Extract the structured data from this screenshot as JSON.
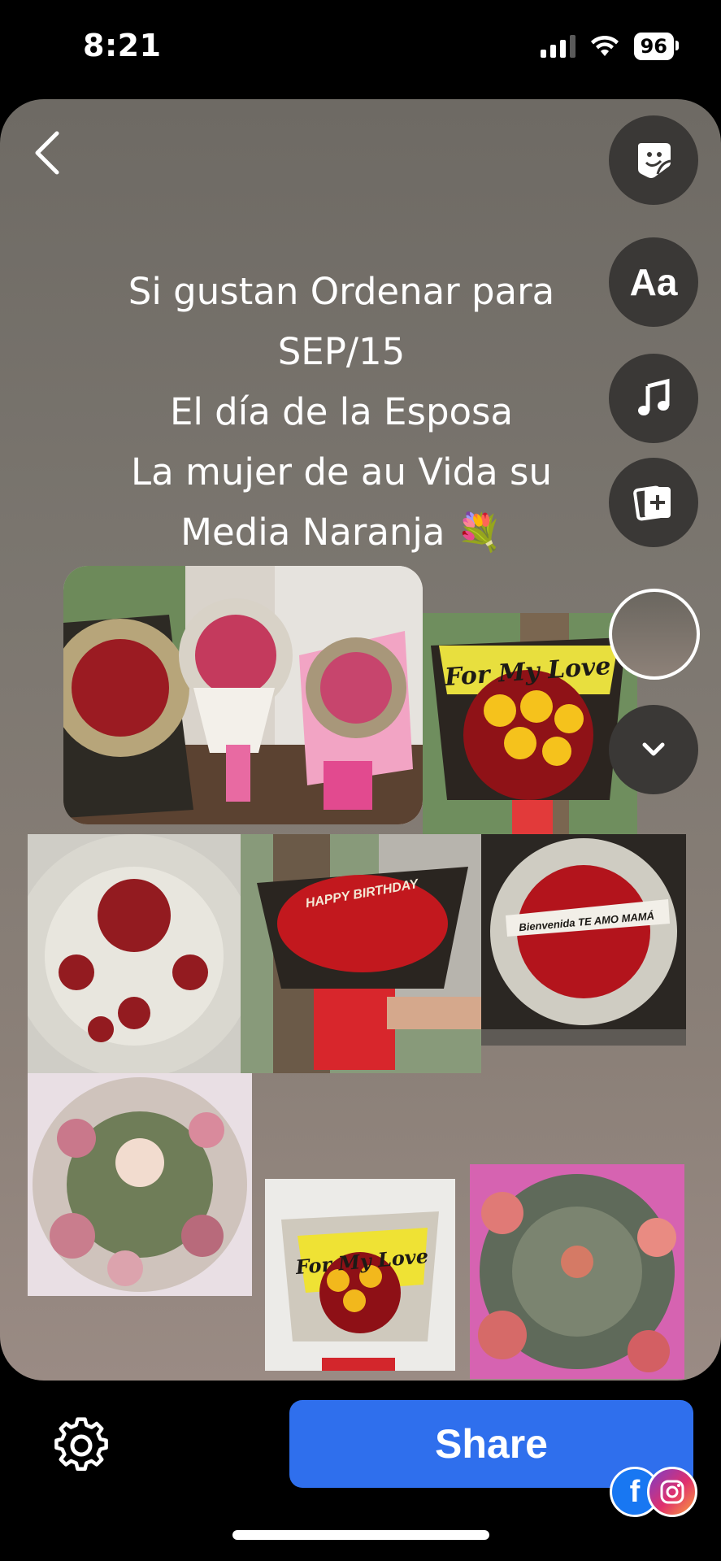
{
  "status": {
    "time": "8:21",
    "battery": "96"
  },
  "caption": {
    "lines": [
      "Si gustan Ordenar para",
      "SEP/15",
      "El día de la Esposa",
      "La mujer de au Vida su",
      "Media Naranja 💐"
    ]
  },
  "tools": {
    "sticker": "sticker-icon",
    "text": "Aa",
    "music": "music-icon",
    "add_media": "add-media-icon",
    "more": "chevron-down-icon"
  },
  "photos": [
    {
      "name": "bouquet-three-money-roses",
      "banner": ""
    },
    {
      "name": "bouquet-for-my-love-sunflowers",
      "banner": "For My Love"
    },
    {
      "name": "bouquet-money-roses-red",
      "banner": ""
    },
    {
      "name": "bouquet-happy-birthday",
      "banner": "HAPPY BIRTHDAY"
    },
    {
      "name": "bouquet-bienvenida-te-amo-mama",
      "banner": "Bienvenida  TE AMO  MAMÁ"
    },
    {
      "name": "bouquet-pink-money-roses",
      "banner": ""
    },
    {
      "name": "bouquet-for-my-love-small",
      "banner": "For My Love"
    },
    {
      "name": "bouquet-money-flower-pink",
      "banner": ""
    }
  ],
  "footer": {
    "share_label": "Share"
  },
  "colors": {
    "share_button": "#2f6fed",
    "card_top": "#6e6a64",
    "card_bottom": "#9a8b84"
  }
}
